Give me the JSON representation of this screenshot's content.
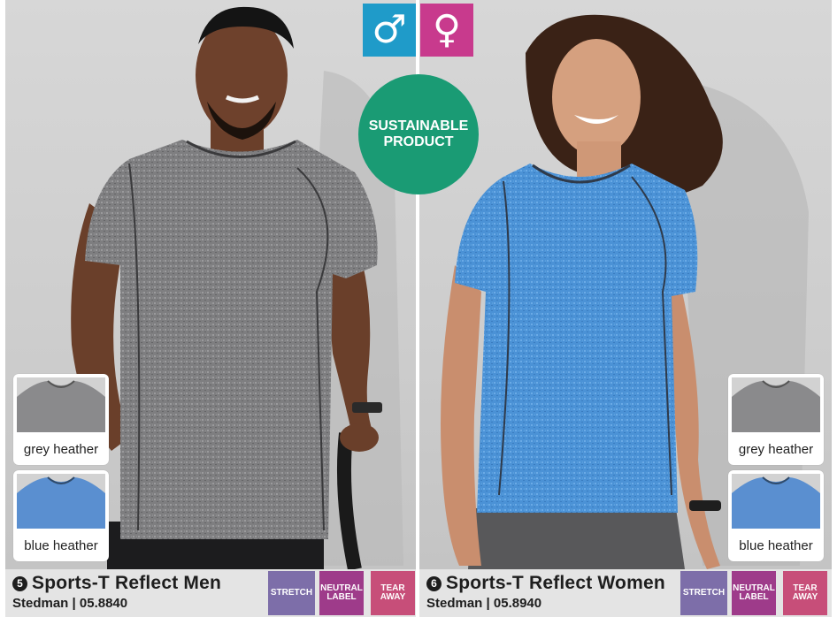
{
  "gender_icons": [
    {
      "glyph": "♂",
      "icon": "male-symbol",
      "color": "#1f9bc9"
    },
    {
      "glyph": "♀",
      "icon": "female-symbol",
      "color": "#c83a8d"
    }
  ],
  "sustainable_badge": {
    "text": "SUSTAINABLE\nPRODUCT",
    "color": "#1a9b74"
  },
  "products": [
    {
      "number": "5",
      "name": "Sports-T Reflect Men",
      "brand_code": "Stedman | 05.8840",
      "colors": [
        "grey heather",
        "blue heather"
      ],
      "badges": [
        "STRETCH",
        "NEUTRAL\nLABEL",
        "TEAR\nAWAY"
      ]
    },
    {
      "number": "6",
      "name": "Sports-T Reflect Women",
      "brand_code": "Stedman | 05.8940",
      "colors": [
        "grey heather",
        "blue heather"
      ],
      "badges": [
        "STRETCH",
        "NEUTRAL\nLABEL",
        "TEAR\nAWAY"
      ]
    }
  ],
  "badge_colors": {
    "stretch": "#7d6ea9",
    "neutral_label": "#9e3b8a",
    "tear_away": "#c74e79"
  }
}
